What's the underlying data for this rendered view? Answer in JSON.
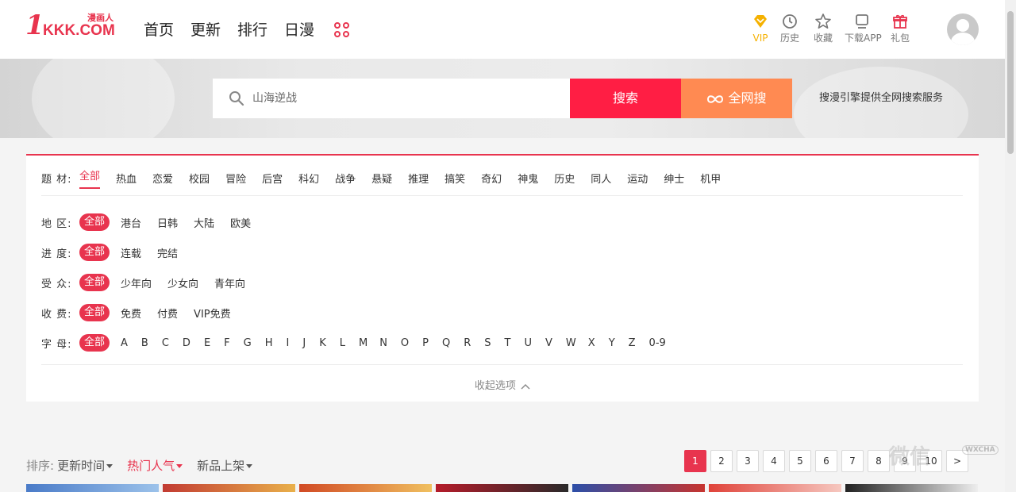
{
  "logo": {
    "one": "1",
    "kkk": "KKK.COM",
    "cn": "漫画人"
  },
  "nav": [
    "首页",
    "更新",
    "排行",
    "日漫"
  ],
  "tools": [
    {
      "icon": "vip-diamond-icon",
      "label": "VIP"
    },
    {
      "icon": "history-clock-icon",
      "label": "历史"
    },
    {
      "icon": "favorite-star-icon",
      "label": "收藏"
    },
    {
      "icon": "download-app-icon",
      "label": "下载APP"
    },
    {
      "icon": "gift-icon",
      "label": "礼包"
    }
  ],
  "search": {
    "placeholder": "山海逆战",
    "button": "搜索",
    "all_button": "全网搜",
    "tip": "搜漫引擎提供全网搜索服务"
  },
  "filters": {
    "theme": {
      "label": "题 材:",
      "options": [
        "全部",
        "热血",
        "恋爱",
        "校园",
        "冒险",
        "后宫",
        "科幻",
        "战争",
        "悬疑",
        "推理",
        "搞笑",
        "奇幻",
        "神鬼",
        "历史",
        "同人",
        "运动",
        "绅士",
        "机甲"
      ]
    },
    "region": {
      "label": "地 区:",
      "options": [
        "全部",
        "港台",
        "日韩",
        "大陆",
        "欧美"
      ]
    },
    "progress": {
      "label": "进 度:",
      "options": [
        "全部",
        "连载",
        "完结"
      ]
    },
    "audience": {
      "label": "受 众:",
      "options": [
        "全部",
        "少年向",
        "少女向",
        "青年向"
      ]
    },
    "fee": {
      "label": "收 费:",
      "options": [
        "全部",
        "免费",
        "付费",
        "VIP免费"
      ]
    },
    "letter": {
      "label": "字 母:",
      "options": [
        "全部",
        "A",
        "B",
        "C",
        "D",
        "E",
        "F",
        "G",
        "H",
        "I",
        "J",
        "K",
        "L",
        "M",
        "N",
        "O",
        "P",
        "Q",
        "R",
        "S",
        "T",
        "U",
        "V",
        "W",
        "X",
        "Y",
        "Z",
        "0-9"
      ]
    },
    "collapse": "收起选项"
  },
  "sort": {
    "label": "排序:",
    "options": [
      "更新时间",
      "热门人气",
      "新品上架"
    ],
    "active": 1
  },
  "pager": [
    "1",
    "2",
    "3",
    "4",
    "5",
    "6",
    "7",
    "8",
    "9",
    "10",
    ">"
  ],
  "watermark": {
    "text": "微信",
    "small": "WXCHA"
  },
  "colors": {
    "accent": "#e8344e",
    "search_btn": "#ff1e44",
    "all_btn": "#ff8a52",
    "vip": "#f5b100"
  }
}
